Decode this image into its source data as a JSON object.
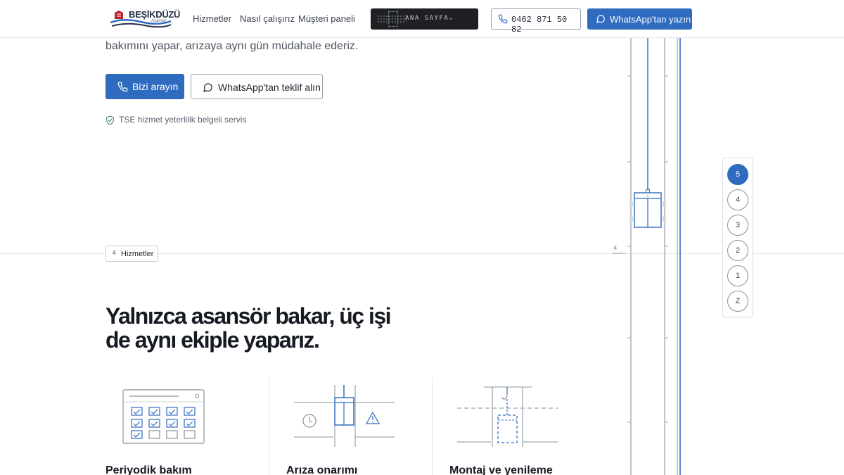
{
  "header": {
    "logo_text": "BEŞİKDÜZÜ",
    "logo_sub": "Asansör",
    "nav": [
      "Hizmetler",
      "Nasıl çalışırız",
      "Müşteri paneli"
    ],
    "floor_select_label": "ANA SAYFA",
    "phone": "0462 871 50 82",
    "whatsapp_label": "WhatsApp'tan yazın",
    "accent_color": "#2f6cc0"
  },
  "hero": {
    "description": "bakımını yapar, arızaya aynı gün müdahale ederiz.",
    "call_button": "Bizi arayın",
    "offer_button": "WhatsApp'tan teklif alın",
    "certification": "TSE hizmet yeterlilik belgeli servis"
  },
  "section": {
    "number": "4",
    "tag": "Hizmetler",
    "title": "Yalnızca asansör bakar, üç işi de aynı ekiple yaparız."
  },
  "services": [
    {
      "title": "Periyodik bakım",
      "icon": "calendar-checklist-icon"
    },
    {
      "title": "Arıza onarımı",
      "icon": "elevator-fault-icon"
    },
    {
      "title": "Montaj ve yenileme",
      "icon": "elevator-installation-icon"
    }
  ],
  "shaft": {
    "floor_marker": "4"
  },
  "floor_panel": {
    "floors": [
      "5",
      "4",
      "3",
      "2",
      "1",
      "Z"
    ],
    "active": "5"
  }
}
